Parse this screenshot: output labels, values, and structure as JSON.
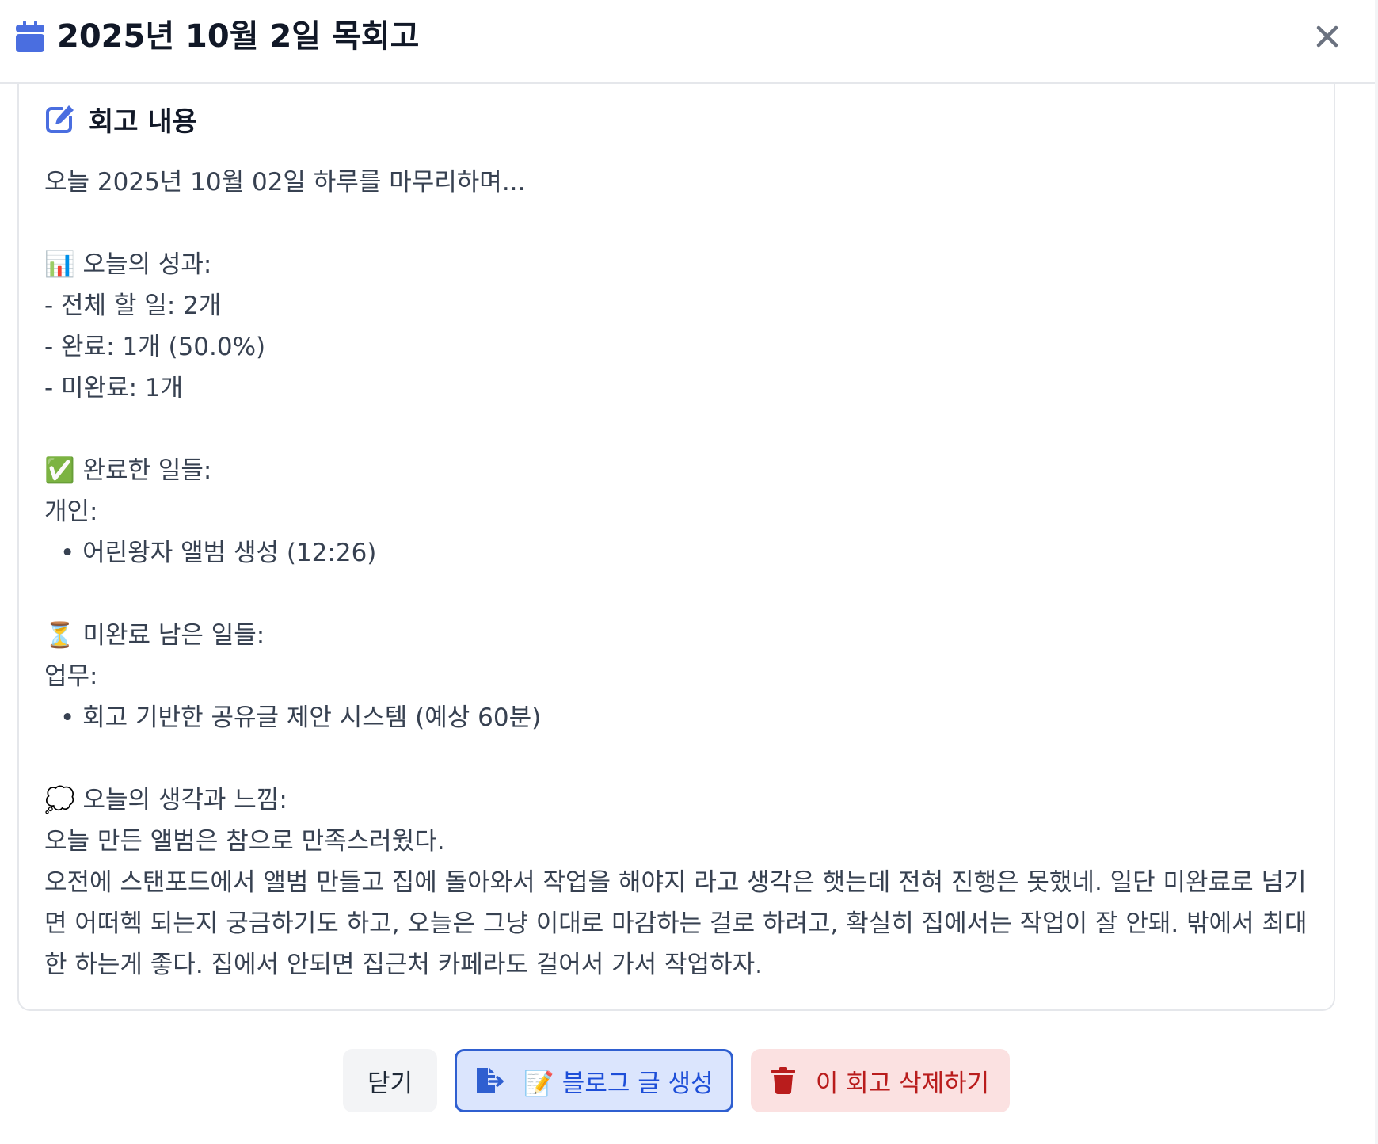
{
  "modal": {
    "title": "2025년 10월 2일 목회고"
  },
  "section": {
    "title": "회고 내용"
  },
  "content": {
    "intro": "오늘 2025년 10월 02일 하루를 마무리하며...",
    "stats_heading": "📊 오늘의 성과:",
    "stats_total": "- 전체 할 일: 2개",
    "stats_done": "- 완료: 1개 (50.0%)",
    "stats_undone": "- 미완료: 1개",
    "done_heading": "✅ 완료한 일들:",
    "done_category": "개인:",
    "done_item": "• 어린왕자 앨범 생성 (12:26)",
    "undone_heading": "⏳ 미완료 남은 일들:",
    "undone_category": "업무:",
    "undone_item": "• 회고 기반한 공유글 제안 시스템 (예상 60분)",
    "thoughts_heading": "💭 오늘의 생각과 느낌:",
    "thoughts_line1": "오늘 만든 앨범은 참으로 만족스러웠다.",
    "thoughts_para": "오전에 스탠포드에서 앨범 만들고 집에 돌아와서 작업을 해야지 라고 생각은 햇는데 전혀 진행은 못했네. 일단 미완료로 넘기면 어떠헥 되는지 궁금하기도 하고, 오늘은 그냥 이대로 마감하는 걸로 하려고, 확실히 집에서는 작업이 잘 안돼. 밖에서 최대한 하는게 좋다. 집에서 안되면 집근처 카페라도 걸어서 가서 작업하자."
  },
  "footer": {
    "close_label": "닫기",
    "blog_label": "📝 블로그 글 생성",
    "delete_label": "이 회고 삭제하기"
  },
  "icons": {
    "header": "calendar-icon",
    "close": "close-icon",
    "section": "edit-icon",
    "blog": "file-export-icon",
    "delete": "trash-icon"
  },
  "colors": {
    "accent_blue": "#4a6ee0",
    "blog_button_bg": "#dbe5fd",
    "blog_button_border": "#2f5fd0",
    "delete_button_bg": "#fbe1e1",
    "delete_text": "#b91c1c",
    "close_button_bg": "#f3f4f6"
  }
}
